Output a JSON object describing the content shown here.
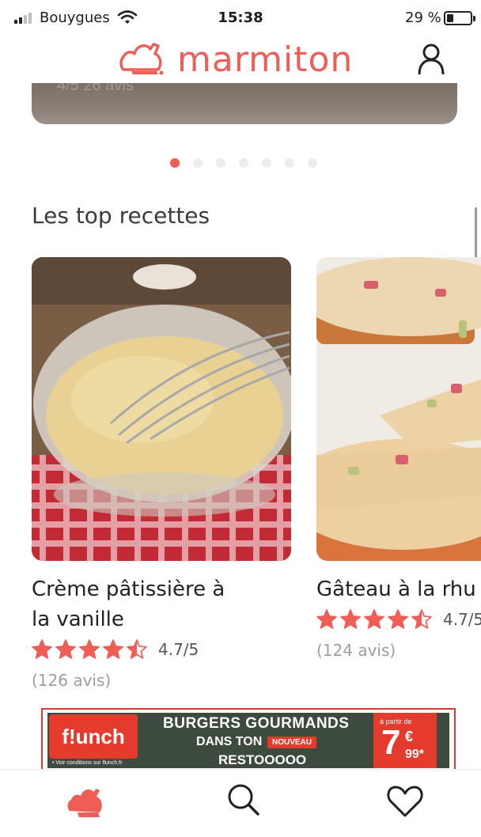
{
  "status_bar": {
    "carrier": "Bouygues",
    "time": "15:38",
    "battery_percent_text": "29 %",
    "battery_level": 0.29,
    "signal_bars_active": 2,
    "signal_bars_total": 4
  },
  "header": {
    "logo_text": "marmiton",
    "logo_icon": "chef-hat-icon",
    "account_icon": "user-icon",
    "brand_color": "#ef5d57"
  },
  "carousel": {
    "ghost_text": "4/5   26 avis",
    "dot_count": 7,
    "active_dot": 0
  },
  "top_recipes": {
    "title": "Les top recettes",
    "items": [
      {
        "title_line1": "Crème pâtissière à",
        "title_line2": "la vanille",
        "stars": 4.5,
        "rating": "4.7/5",
        "reviews": "(126 avis)"
      },
      {
        "title_line1": "Gâteau à la rhu",
        "title_line2": "",
        "stars": 4.5,
        "rating": "4.7/5",
        "reviews": "(124 avis)"
      }
    ]
  },
  "ad": {
    "brand": "f!unch",
    "conditions": "• Voir conditions sur flunch.fr",
    "headline": "BURGERS GOURMANDS",
    "line2": "DANS TON",
    "badge": "NOUVEAU",
    "line3": "RESTOOOOO",
    "price_caption": "à partir de",
    "price_euros": "7",
    "price_sign": "€",
    "price_cents": "99*"
  },
  "tab_bar": {
    "items": [
      {
        "icon": "chef-hat-icon",
        "active": true
      },
      {
        "icon": "search-icon",
        "active": false
      },
      {
        "icon": "heart-icon",
        "active": false
      }
    ]
  }
}
